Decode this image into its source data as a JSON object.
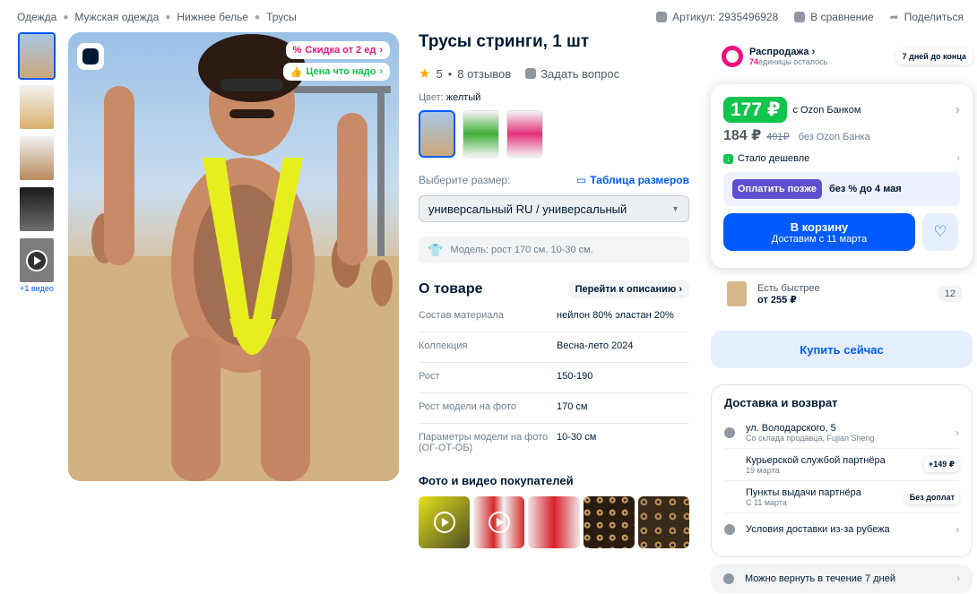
{
  "breadcrumb": [
    "Одежда",
    "Мужская одежда",
    "Нижнее белье",
    "Трусы"
  ],
  "top_actions": {
    "sku": "Артикул: 2935496928",
    "compare": "В сравнение",
    "share": "Поделиться"
  },
  "gallery": {
    "video_label": "+1 видео",
    "badges": {
      "discount": "Скидка от 2 ед",
      "good_price": "Цена что надо"
    }
  },
  "product": {
    "title": "Трусы стринги, 1 шт",
    "rating": "5",
    "reviews": "8 отзывов",
    "ask": "Задать вопрос",
    "color_label": "Цвет:",
    "color_value": "желтый",
    "size_label": "Выберите размер:",
    "size_table": "Таблица размеров",
    "size_value": "универсальный RU / универсальный",
    "model_info": "Модель: рост 170 см. 10-30 см."
  },
  "about": {
    "heading": "О товаре",
    "goto": "Перейти к описанию",
    "specs": [
      {
        "k": "Состав материала",
        "v": "нейлон 80% эластан 20%"
      },
      {
        "k": "Коллекция",
        "v": "Весна-лето 2024"
      },
      {
        "k": "Рост",
        "v": "150-190"
      },
      {
        "k": "Рост модели на фото",
        "v": "170 см"
      },
      {
        "k": "Параметры модели на фото (ОГ-ОТ-ОБ)",
        "v": "10-30 см"
      }
    ]
  },
  "customer_media": {
    "heading": "Фото и видео покупателей"
  },
  "sale": {
    "title": "Распродажа",
    "count": "74",
    "remaining": "единицы осталось",
    "days": "7 дней до конца"
  },
  "price": {
    "card_price": "177 ₽",
    "card_label": "с Ozon Банком",
    "price": "184 ₽",
    "old_price": "491₽",
    "no_card_label": "без Ozon Банка",
    "cheaper": "Стало дешевле",
    "later_button": "Оплатить позже",
    "later_text": "без % до 4 мая",
    "cart_button": "В корзину",
    "cart_sub": "Доставим с 11 марта"
  },
  "faster": {
    "label": "Есть быстрее",
    "price": "от 255 ₽",
    "count": "12"
  },
  "buy_now": "Купить сейчас",
  "delivery": {
    "heading": "Доставка и возврат",
    "address": "ул. Володарского, 5",
    "address_sub": "Со склада продавца, Fujian Sheng",
    "courier": "Курьерской службой партнёра",
    "courier_date": "19 марта",
    "courier_price": "+149 ₽",
    "pickup": "Пункты выдачи партнёра",
    "pickup_date": "С 11 марта",
    "pickup_tag": "Без доплат",
    "abroad": "Условия доставки из-за рубежа",
    "return": "Можно вернуть в течение 7 дней"
  }
}
